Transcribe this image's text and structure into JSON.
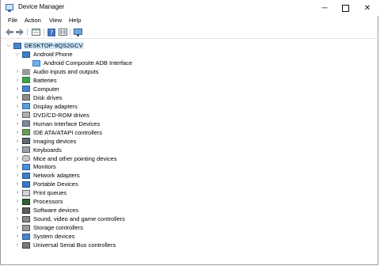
{
  "window": {
    "title": "Device Manager"
  },
  "menu": [
    "File",
    "Action",
    "View",
    "Help"
  ],
  "toolbar": {
    "back_icon": "back-arrow-icon",
    "forward_icon": "forward-arrow-icon",
    "properties_icon": "properties-icon",
    "help_icon": "help-icon",
    "view_icon": "view-icon",
    "monitor_icon": "monitor-icon"
  },
  "tree": {
    "root": "DESKTOP-8QS2GCV",
    "expanded_category": "Android Phone",
    "expanded_child": "Android Composite ADB Interface",
    "categories": [
      "Audio inputs and outputs",
      "Batteries",
      "Computer",
      "Disk drives",
      "Display adapters",
      "DVD/CD-ROM drives",
      "Human Interface Devices",
      "IDE ATA/ATAPI controllers",
      "Imaging devices",
      "Keyboards",
      "Mice and other pointing devices",
      "Monitors",
      "Network adapters",
      "Portable Devices",
      "Print queues",
      "Processors",
      "Software devices",
      "Sound, video and game controllers",
      "Storage controllers",
      "System devices",
      "Universal Serial Bus controllers"
    ]
  },
  "colors": {
    "selection": "#cce8ff",
    "icon_blue": "#3a78c3"
  }
}
